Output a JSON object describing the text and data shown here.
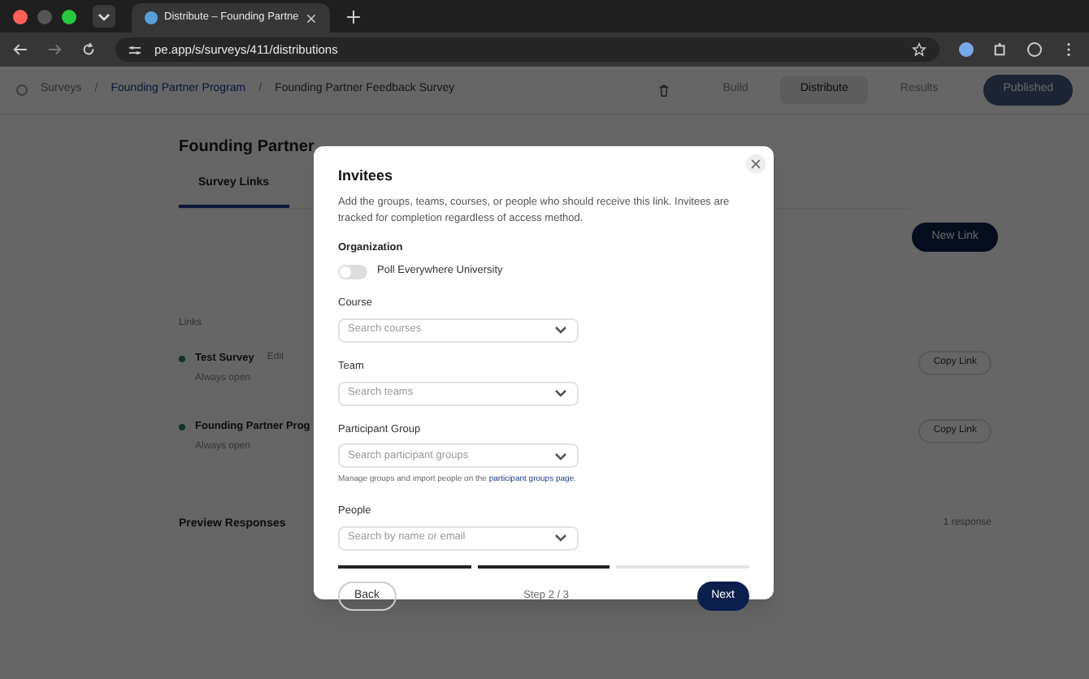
{
  "browser": {
    "tab_title": "Distribute – Founding Partne",
    "url": "pe.app/s/surveys/411/distributions"
  },
  "app_header": {
    "breadcrumbs": [
      "Surveys",
      "Founding Partner Program",
      "Founding Partner Feedback Survey"
    ],
    "separator": "/",
    "nav": [
      {
        "label": "Build",
        "selected": false
      },
      {
        "label": "Distribute",
        "selected": true
      },
      {
        "label": "Results",
        "selected": false
      }
    ],
    "publish_button": "Published"
  },
  "page": {
    "title": "Founding Partner",
    "tabs": [
      {
        "label": "Survey Links",
        "selected": true
      }
    ],
    "new_link_button": "New Link",
    "links_heading": "Links",
    "links": [
      {
        "name": "Test Survey",
        "badge": "Edit",
        "status": "Always open",
        "copy_button": "Copy Link"
      },
      {
        "name": "Founding Partner Prog",
        "status": "Always open",
        "copy_button": "Copy Link"
      }
    ],
    "preview": {
      "title": "Preview Responses",
      "count": "1 response"
    }
  },
  "modal": {
    "title": "Invitees",
    "description": "Add the groups, teams, courses, or people who should receive this link. Invitees are tracked for completion regardless of access method.",
    "organization": {
      "label": "Organization",
      "toggle_label": "Poll Everywhere University",
      "on": false
    },
    "fields": [
      {
        "label": "Course",
        "placeholder": "Search courses"
      },
      {
        "label": "Team",
        "placeholder": "Search teams"
      },
      {
        "label": "Participant Group",
        "placeholder": "Search participant groups",
        "help": "Manage groups and import people on the ",
        "help_link": "participant groups page",
        "help_end": "."
      },
      {
        "label": "People",
        "placeholder": "Search by name or email"
      }
    ],
    "steps": [
      {
        "done": true
      },
      {
        "done": true
      },
      {
        "done": false
      }
    ],
    "back_button": "Back",
    "step_text": "Step 2 / 3",
    "next_button": "Next"
  }
}
